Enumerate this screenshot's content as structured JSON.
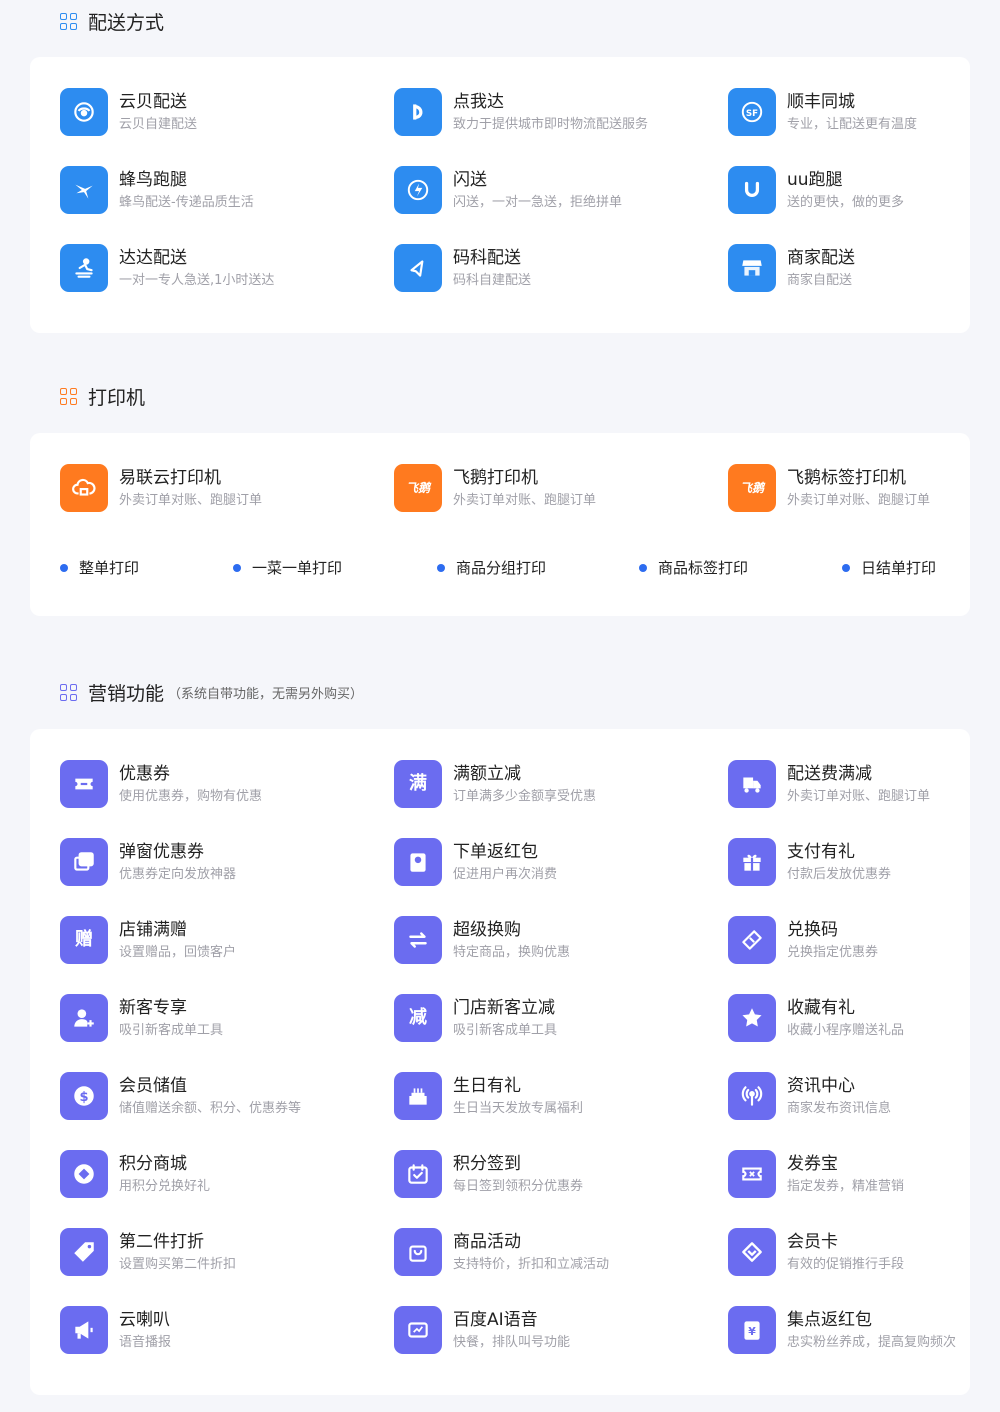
{
  "sections": {
    "delivery": {
      "title": "配送方式",
      "items": [
        {
          "name": "云贝配送",
          "desc": "云贝自建配送",
          "icon": "cloud-delivery-icon"
        },
        {
          "name": "点我达",
          "desc": "致力于提供城市即时物流配送服务",
          "icon": "dianwoda-icon"
        },
        {
          "name": "顺丰同城",
          "desc": "专业，让配送更有温度",
          "icon": "sf-icon"
        },
        {
          "name": "蜂鸟跑腿",
          "desc": "蜂鸟配送-传递品质生活",
          "icon": "hummingbird-icon"
        },
        {
          "name": "闪送",
          "desc": "闪送，一对一急送，拒绝拼单",
          "icon": "lightning-icon"
        },
        {
          "name": "uu跑腿",
          "desc": "送的更快，做的更多",
          "icon": "uu-icon"
        },
        {
          "name": "达达配送",
          "desc": "一对一专人急送,1小时送达",
          "icon": "dada-icon"
        },
        {
          "name": "码科配送",
          "desc": "码科自建配送",
          "icon": "maker-icon"
        },
        {
          "name": "商家配送",
          "desc": "商家自配送",
          "icon": "store-icon"
        }
      ]
    },
    "printer": {
      "title": "打印机",
      "items": [
        {
          "name": "易联云打印机",
          "desc": "外卖订单对账、跑腿订单",
          "icon": "cloud-printer-icon"
        },
        {
          "name": "飞鹅打印机",
          "desc": "外卖订单对账、跑腿订单",
          "icon": "feie-logo-icon",
          "glyph": "飞鹅"
        },
        {
          "name": "飞鹅标签打印机",
          "desc": "外卖订单对账、跑腿订单",
          "icon": "feie-logo-icon",
          "glyph": "飞鹅"
        }
      ],
      "features": [
        "整单打印",
        "一菜一单打印",
        "商品分组打印",
        "商品标签打印",
        "日结单打印"
      ]
    },
    "marketing": {
      "title": "营销功能",
      "subtitle": "（系统自带功能，无需另外购买）",
      "items": [
        {
          "name": "优惠券",
          "desc": "使用优惠券，购物有优惠",
          "icon": "coupon-icon"
        },
        {
          "name": "满额立减",
          "desc": "订单满多少金额享受优惠",
          "icon": "man-text-icon",
          "glyph": "满"
        },
        {
          "name": "配送费满减",
          "desc": "外卖订单对账、跑腿订单",
          "icon": "truck-icon"
        },
        {
          "name": "弹窗优惠券",
          "desc": "优惠券定向发放神器",
          "icon": "popup-icon"
        },
        {
          "name": "下单返红包",
          "desc": "促进用户再次消费",
          "icon": "red-packet-icon"
        },
        {
          "name": "支付有礼",
          "desc": "付款后发放优惠券",
          "icon": "gift-icon"
        },
        {
          "name": "店铺满赠",
          "desc": "设置赠品，回馈客户",
          "icon": "zeng-text-icon",
          "glyph": "赠"
        },
        {
          "name": "超级换购",
          "desc": "特定商品，换购优惠",
          "icon": "swap-icon"
        },
        {
          "name": "兑换码",
          "desc": "兑换指定优惠券",
          "icon": "ticket-icon"
        },
        {
          "name": "新客专享",
          "desc": "吸引新客成单工具",
          "icon": "new-user-icon"
        },
        {
          "name": "门店新客立减",
          "desc": "吸引新客成单工具",
          "icon": "jian-text-icon",
          "glyph": "减"
        },
        {
          "name": "收藏有礼",
          "desc": "收藏小程序赠送礼品",
          "icon": "star-icon"
        },
        {
          "name": "会员储值",
          "desc": "储值赠送余额、积分、优惠券等",
          "icon": "dollar-icon"
        },
        {
          "name": "生日有礼",
          "desc": "生日当天发放专属福利",
          "icon": "cake-icon"
        },
        {
          "name": "资讯中心",
          "desc": "商家发布资讯信息",
          "icon": "broadcast-icon"
        },
        {
          "name": "积分商城",
          "desc": "用积分兑换好礼",
          "icon": "points-icon"
        },
        {
          "name": "积分签到",
          "desc": "每日签到领积分优惠券",
          "icon": "calendar-check-icon"
        },
        {
          "name": "发券宝",
          "desc": "指定发券，精准营销",
          "icon": "voucher-icon"
        },
        {
          "name": "第二件打折",
          "desc": "设置购买第二件折扣",
          "icon": "tag-icon"
        },
        {
          "name": "商品活动",
          "desc": "支持特价，折扣和立减活动",
          "icon": "bag-icon"
        },
        {
          "name": "会员卡",
          "desc": "有效的促销推行手段",
          "icon": "diamond-icon"
        },
        {
          "name": "云喇叭",
          "desc": "语音播报",
          "icon": "megaphone-icon"
        },
        {
          "name": "百度AI语音",
          "desc": "快餐，排队叫号功能",
          "icon": "ai-voice-icon"
        },
        {
          "name": "集点返红包",
          "desc": "忠实粉丝养成，提高复购频次",
          "icon": "yen-packet-icon"
        }
      ]
    }
  },
  "colors": {
    "delivery_accent": "#2d8cf0",
    "printer_accent": "#ff7a1f",
    "marketing_accent": "#6b6cf0",
    "feature_dot": "#2d6cf0"
  }
}
